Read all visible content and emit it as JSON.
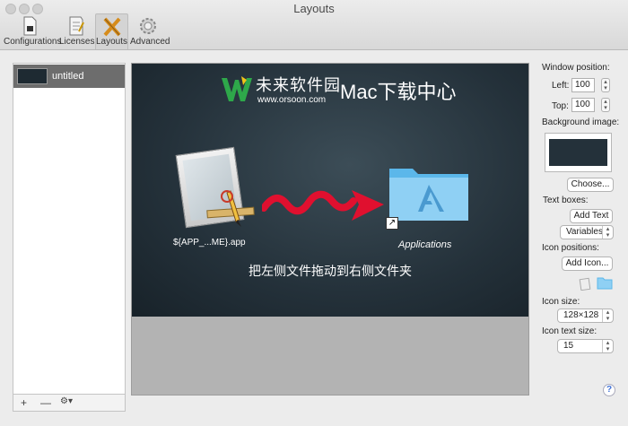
{
  "window": {
    "title": "Layouts"
  },
  "toolbar": {
    "items": [
      {
        "label": "Configurations",
        "icon": "configurations-icon"
      },
      {
        "label": "Licenses",
        "icon": "licenses-icon"
      },
      {
        "label": "Layouts",
        "icon": "layouts-icon",
        "selected": true
      },
      {
        "label": "Advanced",
        "icon": "gear-icon"
      }
    ]
  },
  "sidebar": {
    "items": [
      {
        "label": "untitled",
        "selected": true
      }
    ],
    "footer": {
      "add": "+",
      "remove": "—",
      "action": "⚙▾"
    }
  },
  "canvas": {
    "logo_cn": "未来软件园",
    "logo_url": "www.orsoon.com",
    "logo_mac": "Mac下载中心",
    "app_label": "${APP_...ME}.app",
    "apps_label": "Applications",
    "instruction": "把左侧文件拖动到右侧文件夹",
    "arrow_color": "#e0102f",
    "folder_color": "#5bb7ea"
  },
  "panel": {
    "window_position_label": "Window position:",
    "left_label": "Left:",
    "left_value": "100",
    "top_label": "Top:",
    "top_value": "100",
    "background_image_label": "Background image:",
    "choose_button": "Choose...",
    "text_boxes_label": "Text boxes:",
    "add_text_button": "Add Text",
    "variables_select": "Variables",
    "icon_positions_label": "Icon positions:",
    "add_icon_button": "Add Icon...",
    "icon_size_label": "Icon size:",
    "icon_size_value": "128×128",
    "icon_text_size_label": "Icon text size:",
    "icon_text_size_value": "15",
    "help": "?"
  }
}
